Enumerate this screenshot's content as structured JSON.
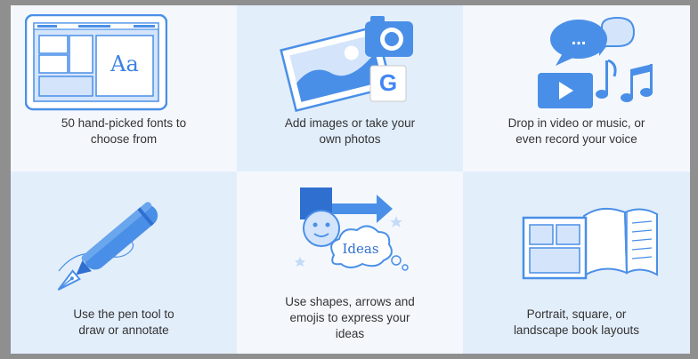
{
  "features": [
    {
      "caption": "50 hand-picked fonts to\nchoose from",
      "icon": "fonts-window-icon",
      "icon_text": "Aa"
    },
    {
      "caption": "Add images or take your\nown photos",
      "icon": "photo-camera-google-icon",
      "icon_text": "G"
    },
    {
      "caption": "Drop in video or music, or\neven record your voice",
      "icon": "video-music-chat-icon",
      "icon_text": "..."
    },
    {
      "caption": "Use the pen tool to\ndraw or annotate",
      "icon": "fountain-pen-icon"
    },
    {
      "caption": "Use shapes, arrows and\nemojis to express your\nideas",
      "icon": "shapes-arrow-emoji-icon",
      "icon_text": "Ideas"
    },
    {
      "caption": "Portrait, square, or\nlandscape book layouts",
      "icon": "book-layouts-icon"
    }
  ],
  "colors": {
    "primary": "#4a8fe7",
    "dark": "#2f6fd0",
    "light_fill": "#d4e5fb",
    "cell_light": "#f4f8fd",
    "cell_blue": "#e3eefb"
  }
}
